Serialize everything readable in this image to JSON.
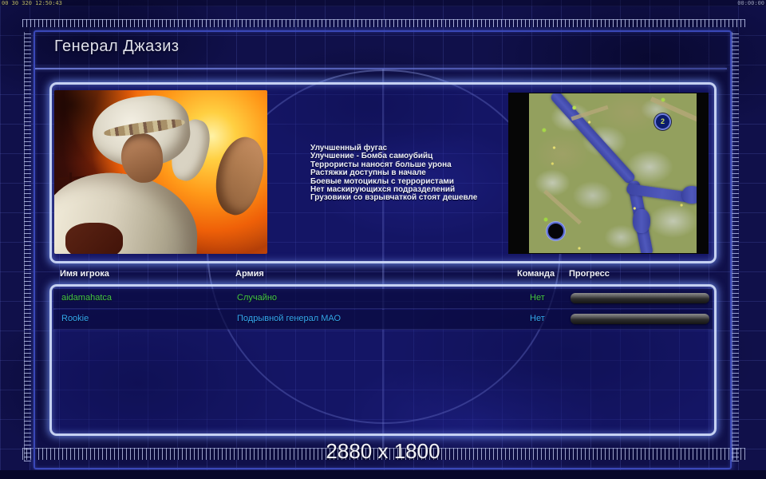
{
  "window": {
    "debug_left": "00 30 320 12:50:43",
    "timer_right": "00:00:00"
  },
  "header": {
    "title": "Генерал Джазиз"
  },
  "bonuses": [
    "Улучшенный фугас",
    "Улучшение - Бомба самоубийц",
    "Террористы наносят больше урона",
    "Растяжки доступны в начале",
    "Боевые мотоциклы с террористами",
    "Нет маскирующихся подразделений",
    "Грузовики со взрывчаткой стоят дешевле"
  ],
  "minimap": {
    "markers": [
      {
        "label": "2",
        "position": "top-right"
      },
      {
        "label": "",
        "position": "bottom-left"
      }
    ]
  },
  "lobby": {
    "columns": {
      "name": "Имя игрока",
      "army": "Армия",
      "team": "Команда",
      "progress": "Прогресс"
    },
    "players": [
      {
        "name": "aidamahatca",
        "army": "Случайно",
        "team": "Нет",
        "color": "#46c846",
        "progress_percent": 0
      },
      {
        "name": "Rookie",
        "army": "Подрывной генерал МАО",
        "team": "Нет",
        "color": "#35a8f0",
        "progress_percent": 0
      }
    ]
  },
  "footer": {
    "resolution": "2880 x 1800"
  },
  "colors": {
    "background": "#10104a",
    "frame_border": "#3a48b8",
    "panel_glow": "#d0dcfa",
    "panel_fill": "#1e2094",
    "title_text": "#dfe0ea",
    "bonus_text": "#eef0f8",
    "header_text": "#f2f3fa",
    "progress_empty_top": "#8e8e8e",
    "progress_empty_bottom": "#161616",
    "river": "#4f58bc",
    "terrain": "#93a05e"
  }
}
